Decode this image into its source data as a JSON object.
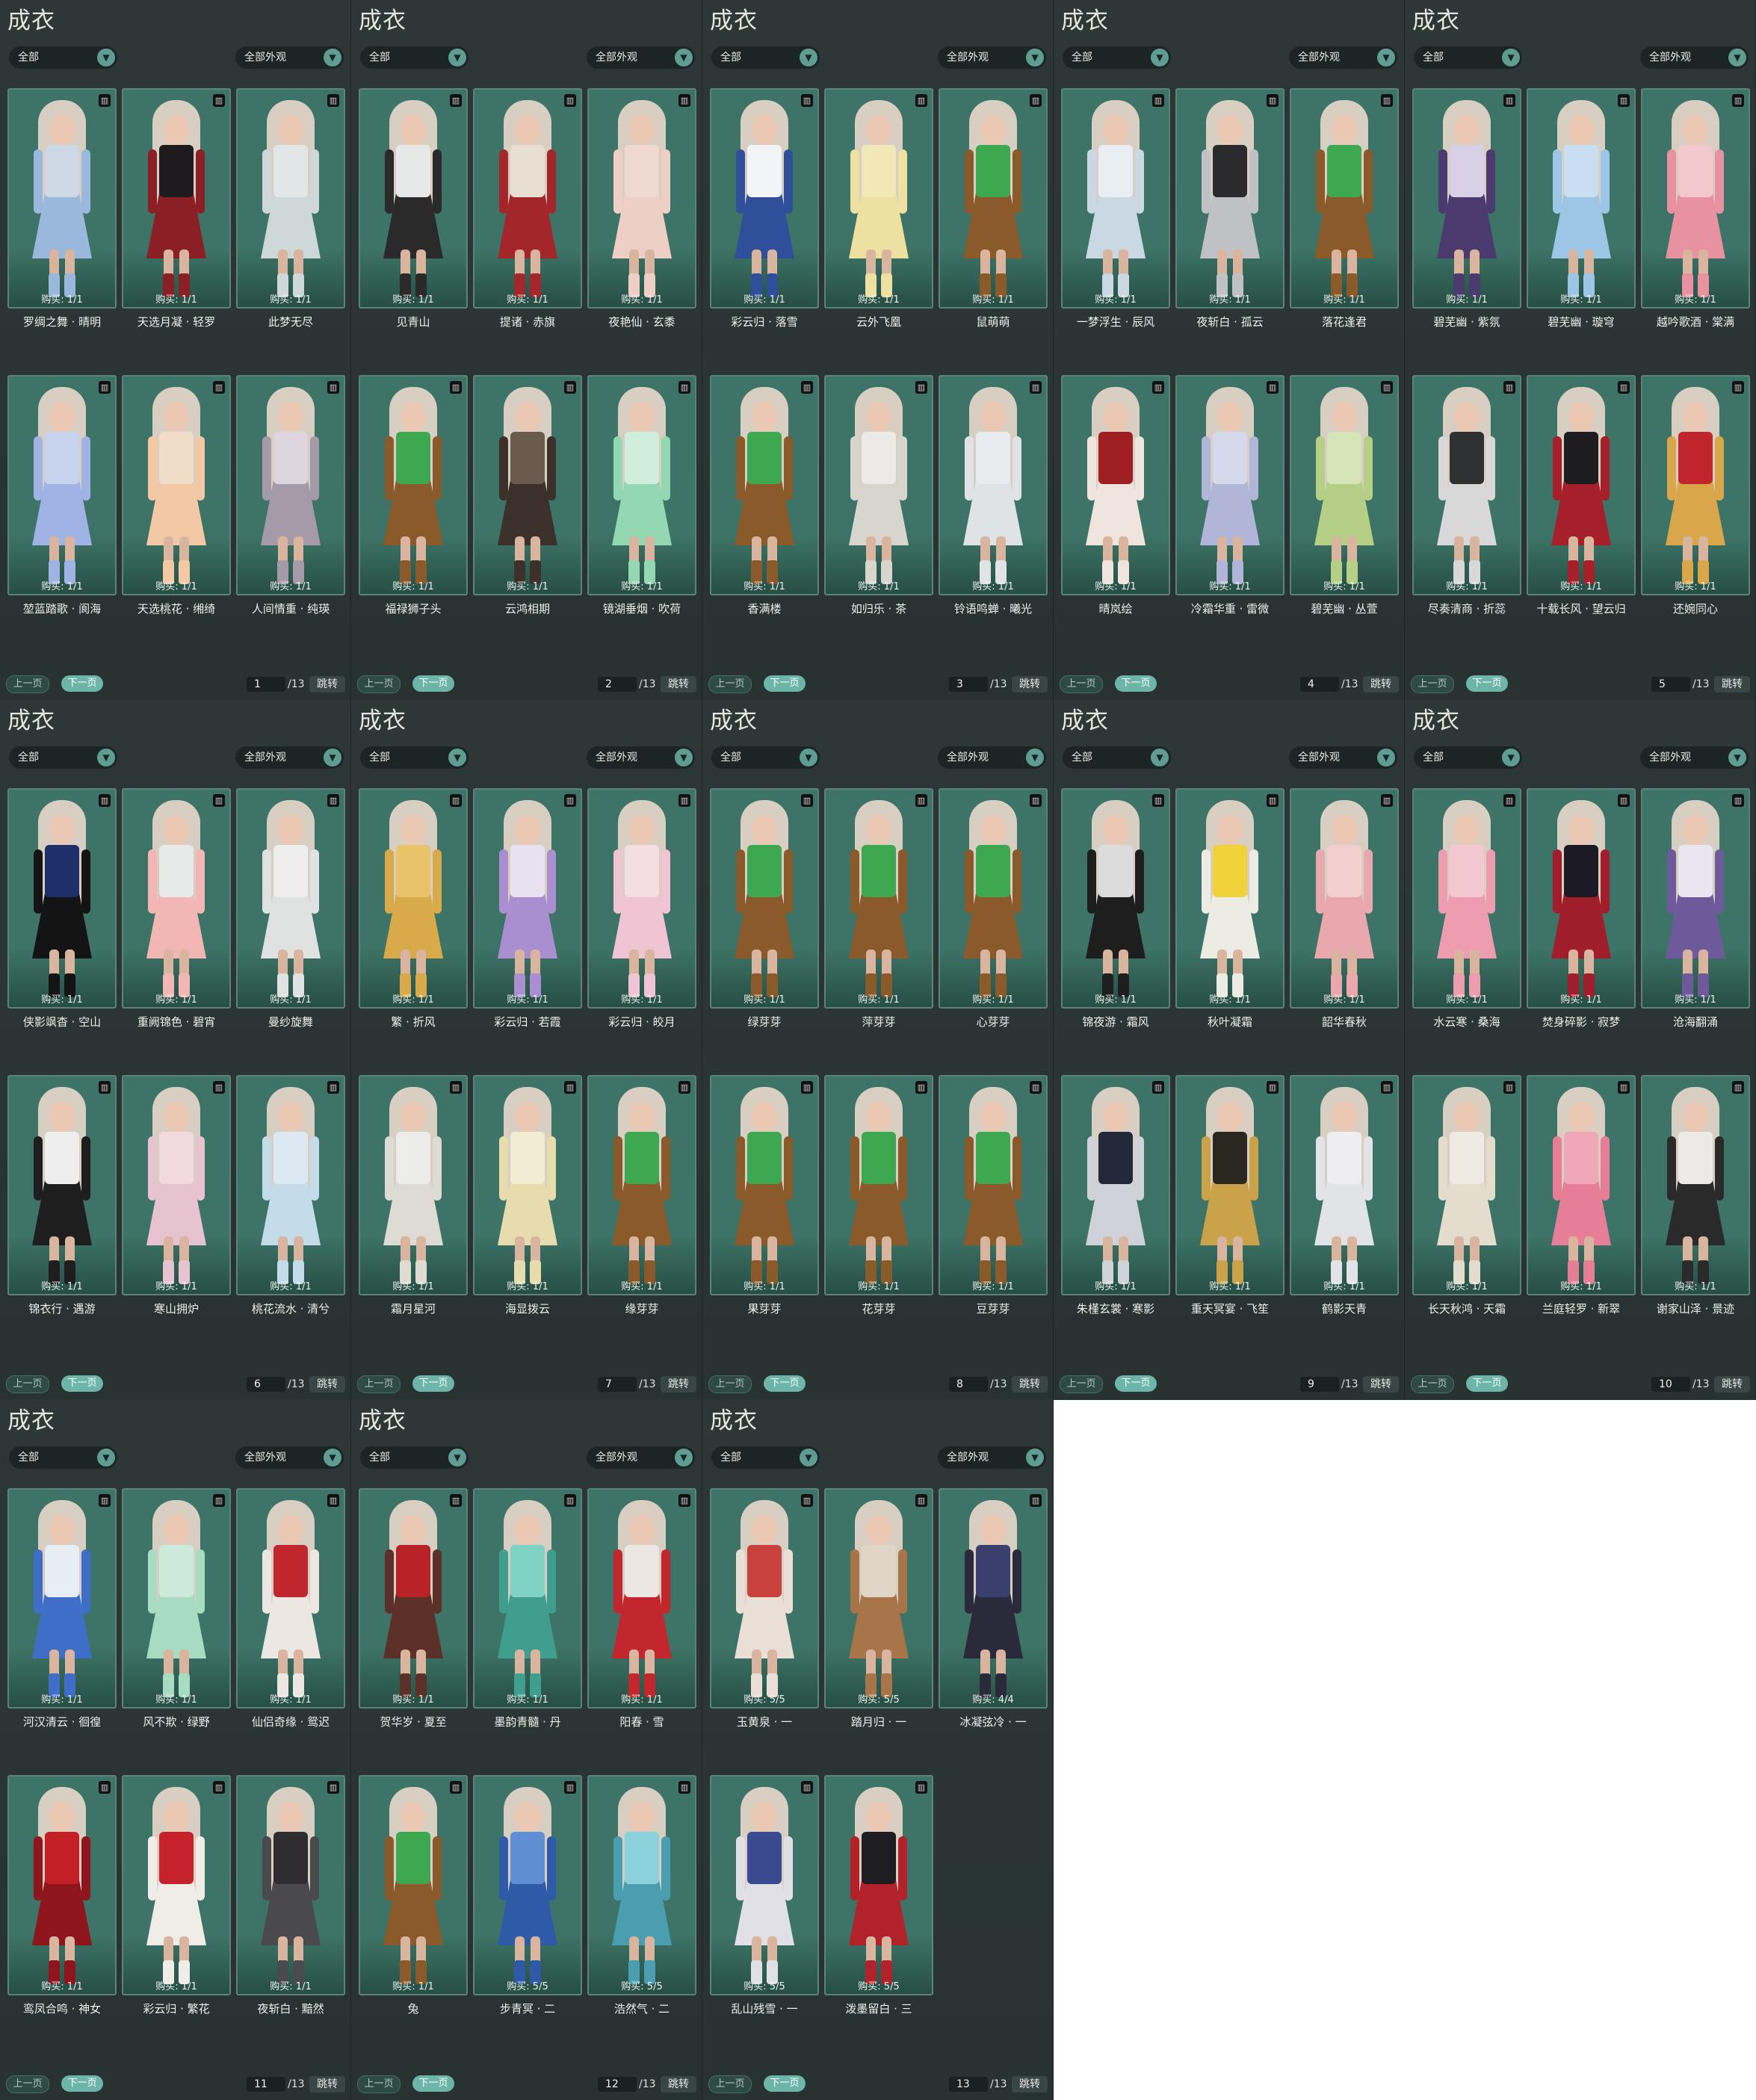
{
  "panel_title": "成衣",
  "filter_left": "全部",
  "filter_right": "全部外观",
  "dropdown_icon": "chevron-down-icon",
  "buttons": {
    "prev": "上一页",
    "next": "下一页",
    "jump": "跳转"
  },
  "total_pages": "/13",
  "pages": [
    {
      "page": "1",
      "items": [
        {
          "name": "罗绸之舞 · 晴明",
          "buy": "购买: 1/1",
          "colors": [
            "#cfd9e6",
            "#9ab7dc"
          ]
        },
        {
          "name": "天选月凝 · 轻罗",
          "buy": "购买: 1/1",
          "colors": [
            "#1e1a1d",
            "#8a1f25"
          ]
        },
        {
          "name": "此梦无尽",
          "buy": "购买: 1/1",
          "colors": [
            "#e2e6e6",
            "#cfd8d9"
          ]
        },
        {
          "name": "堃蓝踏歌 · 阆海",
          "buy": "购买: 1/1",
          "colors": [
            "#c8d3ee",
            "#9fb3e4"
          ]
        },
        {
          "name": "天选桃花 · 缃绮",
          "buy": "购买: 1/1",
          "colors": [
            "#f1ddc7",
            "#f2c9a4"
          ]
        },
        {
          "name": "人间情重 · 纯瑛",
          "buy": "购买: 1/1",
          "colors": [
            "#ddd6df",
            "#a59aa8"
          ]
        }
      ]
    },
    {
      "page": "2",
      "items": [
        {
          "name": "见青山",
          "buy": "购买: 1/1",
          "colors": [
            "#e6e9e8",
            "#2a2a2a"
          ]
        },
        {
          "name": "提诸 · 赤旗",
          "buy": "购买: 1/1",
          "colors": [
            "#e8dfd2",
            "#a3262a"
          ]
        },
        {
          "name": "夜艳仙 · 玄黍",
          "buy": "购买: 1/1",
          "colors": [
            "#efd8d0",
            "#eecfc6"
          ]
        },
        {
          "name": "福禄狮子头",
          "buy": "购买: 1/1",
          "colors": [
            "#3da84f",
            "#8a5a2a"
          ]
        },
        {
          "name": "云鸿相期",
          "buy": "购买: 1/1",
          "colors": [
            "#6b5a4e",
            "#3b302a"
          ]
        },
        {
          "name": "镜湖垂烟 · 吹荷",
          "buy": "购买: 1/1",
          "colors": [
            "#cfeedc",
            "#93d8b3"
          ]
        }
      ]
    },
    {
      "page": "3",
      "items": [
        {
          "name": "彩云归 · 落雪",
          "buy": "购买: 1/1",
          "colors": [
            "#f2f4f8",
            "#2f4f9a"
          ]
        },
        {
          "name": "云外飞凰",
          "buy": "购买: 1/1",
          "colors": [
            "#f2e7b6",
            "#eee0a0"
          ]
        },
        {
          "name": "鼠萌萌",
          "buy": "购买: 1/1",
          "colors": [
            "#3da84f",
            "#8a5a2a"
          ]
        },
        {
          "name": "香满楼",
          "buy": "购买: 1/1",
          "colors": [
            "#3da84f",
            "#8a5a2a"
          ]
        },
        {
          "name": "如归乐 · 茶",
          "buy": "购买: 1/1",
          "colors": [
            "#eceae6",
            "#d8d4ce"
          ]
        },
        {
          "name": "铃语鸣蝉 · 曦光",
          "buy": "购买: 1/1",
          "colors": [
            "#e9ecee",
            "#dfe3e6"
          ]
        }
      ]
    },
    {
      "page": "4",
      "items": [
        {
          "name": "一梦浮生 · 辰风",
          "buy": "购买: 1/1",
          "colors": [
            "#e8eef2",
            "#c9d8e3"
          ]
        },
        {
          "name": "夜斩白 · 孤云",
          "buy": "购买: 1/1",
          "colors": [
            "#2b2b2e",
            "#bfc1c4"
          ]
        },
        {
          "name": "落花逢君",
          "buy": "购买: 1/1",
          "colors": [
            "#3da84f",
            "#8a5a2a"
          ]
        },
        {
          "name": "晴岚绘",
          "buy": "购买: 1/1",
          "colors": [
            "#9e1e22",
            "#efe4de"
          ]
        },
        {
          "name": "冷霜华重 · 雷微",
          "buy": "购买: 1/1",
          "colors": [
            "#d6d9ec",
            "#b1b6d8"
          ]
        },
        {
          "name": "碧芜幽 · 丛萱",
          "buy": "购买: 1/1",
          "colors": [
            "#d6e5b7",
            "#b5cf86"
          ]
        }
      ]
    },
    {
      "page": "5",
      "items": [
        {
          "name": "碧芜幽 · 紫氛",
          "buy": "购买: 1/1",
          "colors": [
            "#d8d0e6",
            "#4a3a6e"
          ]
        },
        {
          "name": "碧芜幽 · 璇穹",
          "buy": "购买: 1/1",
          "colors": [
            "#c9def0",
            "#9cc5e6"
          ]
        },
        {
          "name": "越吟歌酒 · 棠满",
          "buy": "购买: 1/1",
          "colors": [
            "#f2c8cc",
            "#e891a0"
          ]
        },
        {
          "name": "尽奏清商 · 折蕊",
          "buy": "购买: 1/1",
          "colors": [
            "#2f3032",
            "#d8d8d8"
          ]
        },
        {
          "name": "十载长风 · 望云归",
          "buy": "购买: 1/1",
          "colors": [
            "#1d1d20",
            "#a5202a"
          ]
        },
        {
          "name": "还婉同心",
          "buy": "购买: 1/1",
          "colors": [
            "#c0252b",
            "#d9a64a"
          ]
        }
      ]
    },
    {
      "page": "6",
      "items": [
        {
          "name": "侠影飒杳 · 空山",
          "buy": "购买: 1/1",
          "colors": [
            "#1e2f6a",
            "#141414"
          ]
        },
        {
          "name": "重阙锦色 · 碧宵",
          "buy": "购买: 1/1",
          "colors": [
            "#e8eae9",
            "#f2b7b4"
          ]
        },
        {
          "name": "曼纱旋舞",
          "buy": "购买: 1/1",
          "colors": [
            "#eeeeee",
            "#e0e2e2"
          ]
        },
        {
          "name": "锦衣行 · 遇游",
          "buy": "购买: 1/1",
          "colors": [
            "#efeeee",
            "#1e1e1e"
          ]
        },
        {
          "name": "寒山拥炉",
          "buy": "购买: 1/1",
          "colors": [
            "#f2d9e0",
            "#e7c2cf"
          ]
        },
        {
          "name": "桃花流水 · 清兮",
          "buy": "购买: 1/1",
          "colors": [
            "#dce9f2",
            "#c4dbe9"
          ]
        }
      ]
    },
    {
      "page": "7",
      "items": [
        {
          "name": "繁 · 折风",
          "buy": "购买: 1/1",
          "colors": [
            "#e9c36a",
            "#d9aa4a"
          ]
        },
        {
          "name": "彩云归 · 若霞",
          "buy": "购买: 1/1",
          "colors": [
            "#e8e2f0",
            "#a98fd0"
          ]
        },
        {
          "name": "彩云归 · 皎月",
          "buy": "购买: 1/1",
          "colors": [
            "#f5dde4",
            "#f0c4d2"
          ]
        },
        {
          "name": "霜月星河",
          "buy": "购买: 1/1",
          "colors": [
            "#ececea",
            "#dedbd5"
          ]
        },
        {
          "name": "海显拨云",
          "buy": "购买: 1/1",
          "colors": [
            "#f2ecd2",
            "#e7dcae"
          ]
        },
        {
          "name": "缘芽芽",
          "buy": "购买: 1/1",
          "colors": [
            "#3da84f",
            "#8a5a2a"
          ]
        }
      ]
    },
    {
      "page": "8",
      "items": [
        {
          "name": "绿芽芽",
          "buy": "购买: 1/1",
          "colors": [
            "#3da84f",
            "#8a5a2a"
          ]
        },
        {
          "name": "萍芽芽",
          "buy": "购买: 1/1",
          "colors": [
            "#3da84f",
            "#8a5a2a"
          ]
        },
        {
          "name": "心芽芽",
          "buy": "购买: 1/1",
          "colors": [
            "#3da84f",
            "#8a5a2a"
          ]
        },
        {
          "name": "果芽芽",
          "buy": "购买: 1/1",
          "colors": [
            "#3da84f",
            "#8a5a2a"
          ]
        },
        {
          "name": "花芽芽",
          "buy": "购买: 1/1",
          "colors": [
            "#3da84f",
            "#8a5a2a"
          ]
        },
        {
          "name": "豆芽芽",
          "buy": "购买: 1/1",
          "colors": [
            "#3da84f",
            "#8a5a2a"
          ]
        }
      ]
    },
    {
      "page": "9",
      "items": [
        {
          "name": "锦夜游 · 霜风",
          "buy": "购买: 1/1",
          "colors": [
            "#dcdcdc",
            "#1e1e1e"
          ]
        },
        {
          "name": "秋叶凝霜",
          "buy": "购买: 1/1",
          "colors": [
            "#f2d23a",
            "#ecebe4"
          ]
        },
        {
          "name": "韶华春秋",
          "buy": "购买: 1/1",
          "colors": [
            "#f3cfd0",
            "#e8a8ad"
          ]
        },
        {
          "name": "朱槿玄裳 · 寒影",
          "buy": "购买: 1/1",
          "colors": [
            "#23283a",
            "#cfd2d8"
          ]
        },
        {
          "name": "重天冥宴 · 飞笙",
          "buy": "购买: 1/1",
          "colors": [
            "#2a2620",
            "#c9a24a"
          ]
        },
        {
          "name": "鹤影天青",
          "buy": "购买: 1/1",
          "colors": [
            "#eeeef0",
            "#e2e3e7"
          ]
        }
      ]
    },
    {
      "page": "10",
      "items": [
        {
          "name": "水云寒 · 桑海",
          "buy": "购买: 1/1",
          "colors": [
            "#f4c8d2",
            "#ee9db0"
          ]
        },
        {
          "name": "焚身碎影 · 寂梦",
          "buy": "购买: 1/1",
          "colors": [
            "#1c1a22",
            "#a01e2c"
          ]
        },
        {
          "name": "沧海翻涌",
          "buy": "购买: 1/1",
          "colors": [
            "#e9e6f0",
            "#6e5a9a"
          ]
        },
        {
          "name": "长天秋鸿 · 天霜",
          "buy": "购买: 1/1",
          "colors": [
            "#efeae2",
            "#e4dccd"
          ]
        },
        {
          "name": "兰庭轻罗 · 新翠",
          "buy": "购买: 1/1",
          "colors": [
            "#f0a8b8",
            "#e77e98"
          ]
        },
        {
          "name": "谢家山泽 · 景迹",
          "buy": "购买: 1/1",
          "colors": [
            "#eceae6",
            "#2a2a2a"
          ]
        }
      ]
    },
    {
      "page": "11",
      "items": [
        {
          "name": "河汉清云 · 徊徨",
          "buy": "购买: 1/1",
          "colors": [
            "#e8ecf3",
            "#3f6ec8"
          ]
        },
        {
          "name": "风不欺 · 绿野",
          "buy": "购买: 1/1",
          "colors": [
            "#cde9dc",
            "#a7dcc2"
          ]
        },
        {
          "name": "仙侣奇缘 · 鸳迟",
          "buy": "购买: 1/1",
          "colors": [
            "#c0262e",
            "#ece7e2"
          ]
        },
        {
          "name": "鸾凤合鸣 · 神女",
          "buy": "购买: 1/1",
          "colors": [
            "#c21f27",
            "#8e151b"
          ]
        },
        {
          "name": "彩云归 · 繁花",
          "buy": "购买: 1/1",
          "colors": [
            "#c6222b",
            "#f0ece8"
          ]
        },
        {
          "name": "夜斩白 · 黯然",
          "buy": "购买: 1/1",
          "colors": [
            "#2e2e30",
            "#4a4a4c"
          ]
        }
      ]
    },
    {
      "page": "12",
      "items": [
        {
          "name": "贺华岁 · 夏至",
          "buy": "购买: 1/1",
          "colors": [
            "#b8232a",
            "#5a3028"
          ]
        },
        {
          "name": "墨韵青髓 · 丹",
          "buy": "购买: 1/1",
          "colors": [
            "#7fd2c4",
            "#3f9e8e"
          ]
        },
        {
          "name": "阳春 · 雪",
          "buy": "购买: 1/1",
          "colors": [
            "#ece7e2",
            "#c2272e"
          ]
        },
        {
          "name": "兔",
          "buy": "购买: 1/1",
          "colors": [
            "#3da84f",
            "#8a5a2a"
          ]
        },
        {
          "name": "步青冥 · 二",
          "buy": "购买: 5/5",
          "colors": [
            "#5f8fd2",
            "#2f5aa8"
          ]
        },
        {
          "name": "浩然气 · 二",
          "buy": "购买: 5/5",
          "colors": [
            "#8cd2dc",
            "#4a9eb0"
          ]
        }
      ]
    },
    {
      "page": "13",
      "items": [
        {
          "name": "玉黄泉 · 一",
          "buy": "购买: 5/5",
          "colors": [
            "#c9413c",
            "#e9dfd6"
          ]
        },
        {
          "name": "踏月归 · 一",
          "buy": "购买: 5/5",
          "colors": [
            "#e0d6c8",
            "#a8744a"
          ]
        },
        {
          "name": "冰凝弦冷 · 一",
          "buy": "购买: 4/4",
          "colors": [
            "#3a3f6e",
            "#2a2a3a"
          ]
        },
        {
          "name": "乱山残雪 · 一",
          "buy": "购买: 5/5",
          "colors": [
            "#3a4a8e",
            "#e0e0e6"
          ]
        },
        {
          "name": "泼墨留白 · 三",
          "buy": "购买: 5/5",
          "colors": [
            "#1e1e22",
            "#b2222a"
          ]
        }
      ]
    }
  ]
}
